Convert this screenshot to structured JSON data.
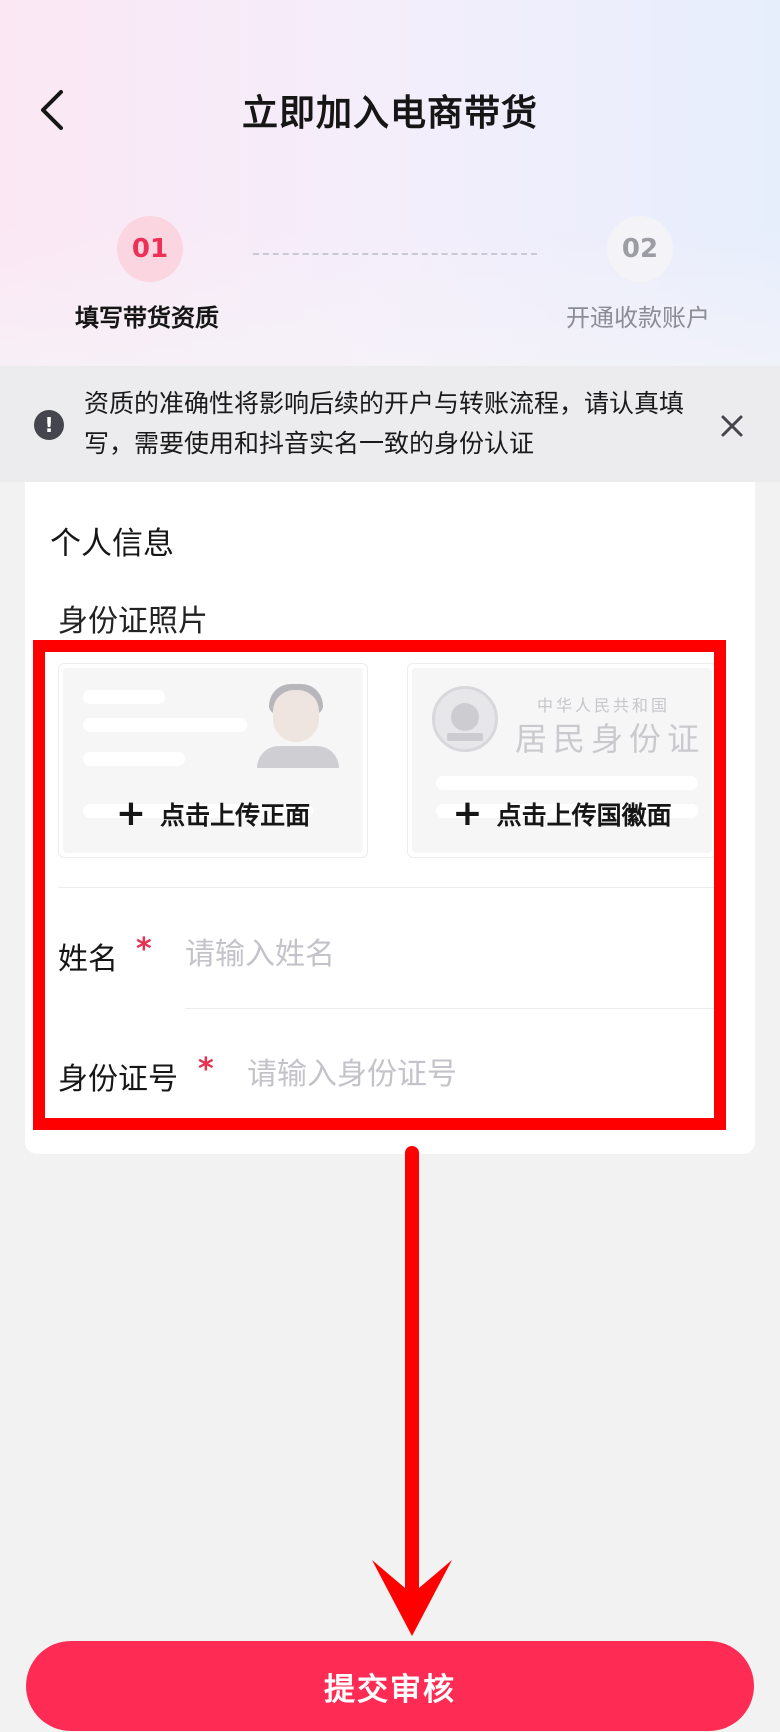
{
  "header": {
    "title": "立即加入电商带货"
  },
  "steps": [
    {
      "number": "01",
      "label": "填写带货资质",
      "state": "active"
    },
    {
      "number": "02",
      "label": "开通收款账户",
      "state": "inactive"
    }
  ],
  "notice": {
    "text": "资质的准确性将影响后续的开户与转账流程，请认真填写，需要使用和抖音实名一致的身份认证"
  },
  "section": {
    "title": "个人信息",
    "id_photo_label": "身份证照片",
    "upload_front": {
      "action": "点击上传正面"
    },
    "upload_back": {
      "country": "中华人民共和国",
      "card_title": "居民身份证",
      "action": "点击上传国徽面"
    }
  },
  "form": {
    "name": {
      "label": "姓名",
      "required_mark": "*",
      "placeholder": "请输入姓名"
    },
    "id_number": {
      "label": "身份证号",
      "required_mark": "*",
      "placeholder": "请输入身份证号"
    }
  },
  "footer": {
    "submit_label": "提交审核"
  },
  "colors": {
    "accent": "#fe2c55",
    "annotation": "#ff0000"
  }
}
